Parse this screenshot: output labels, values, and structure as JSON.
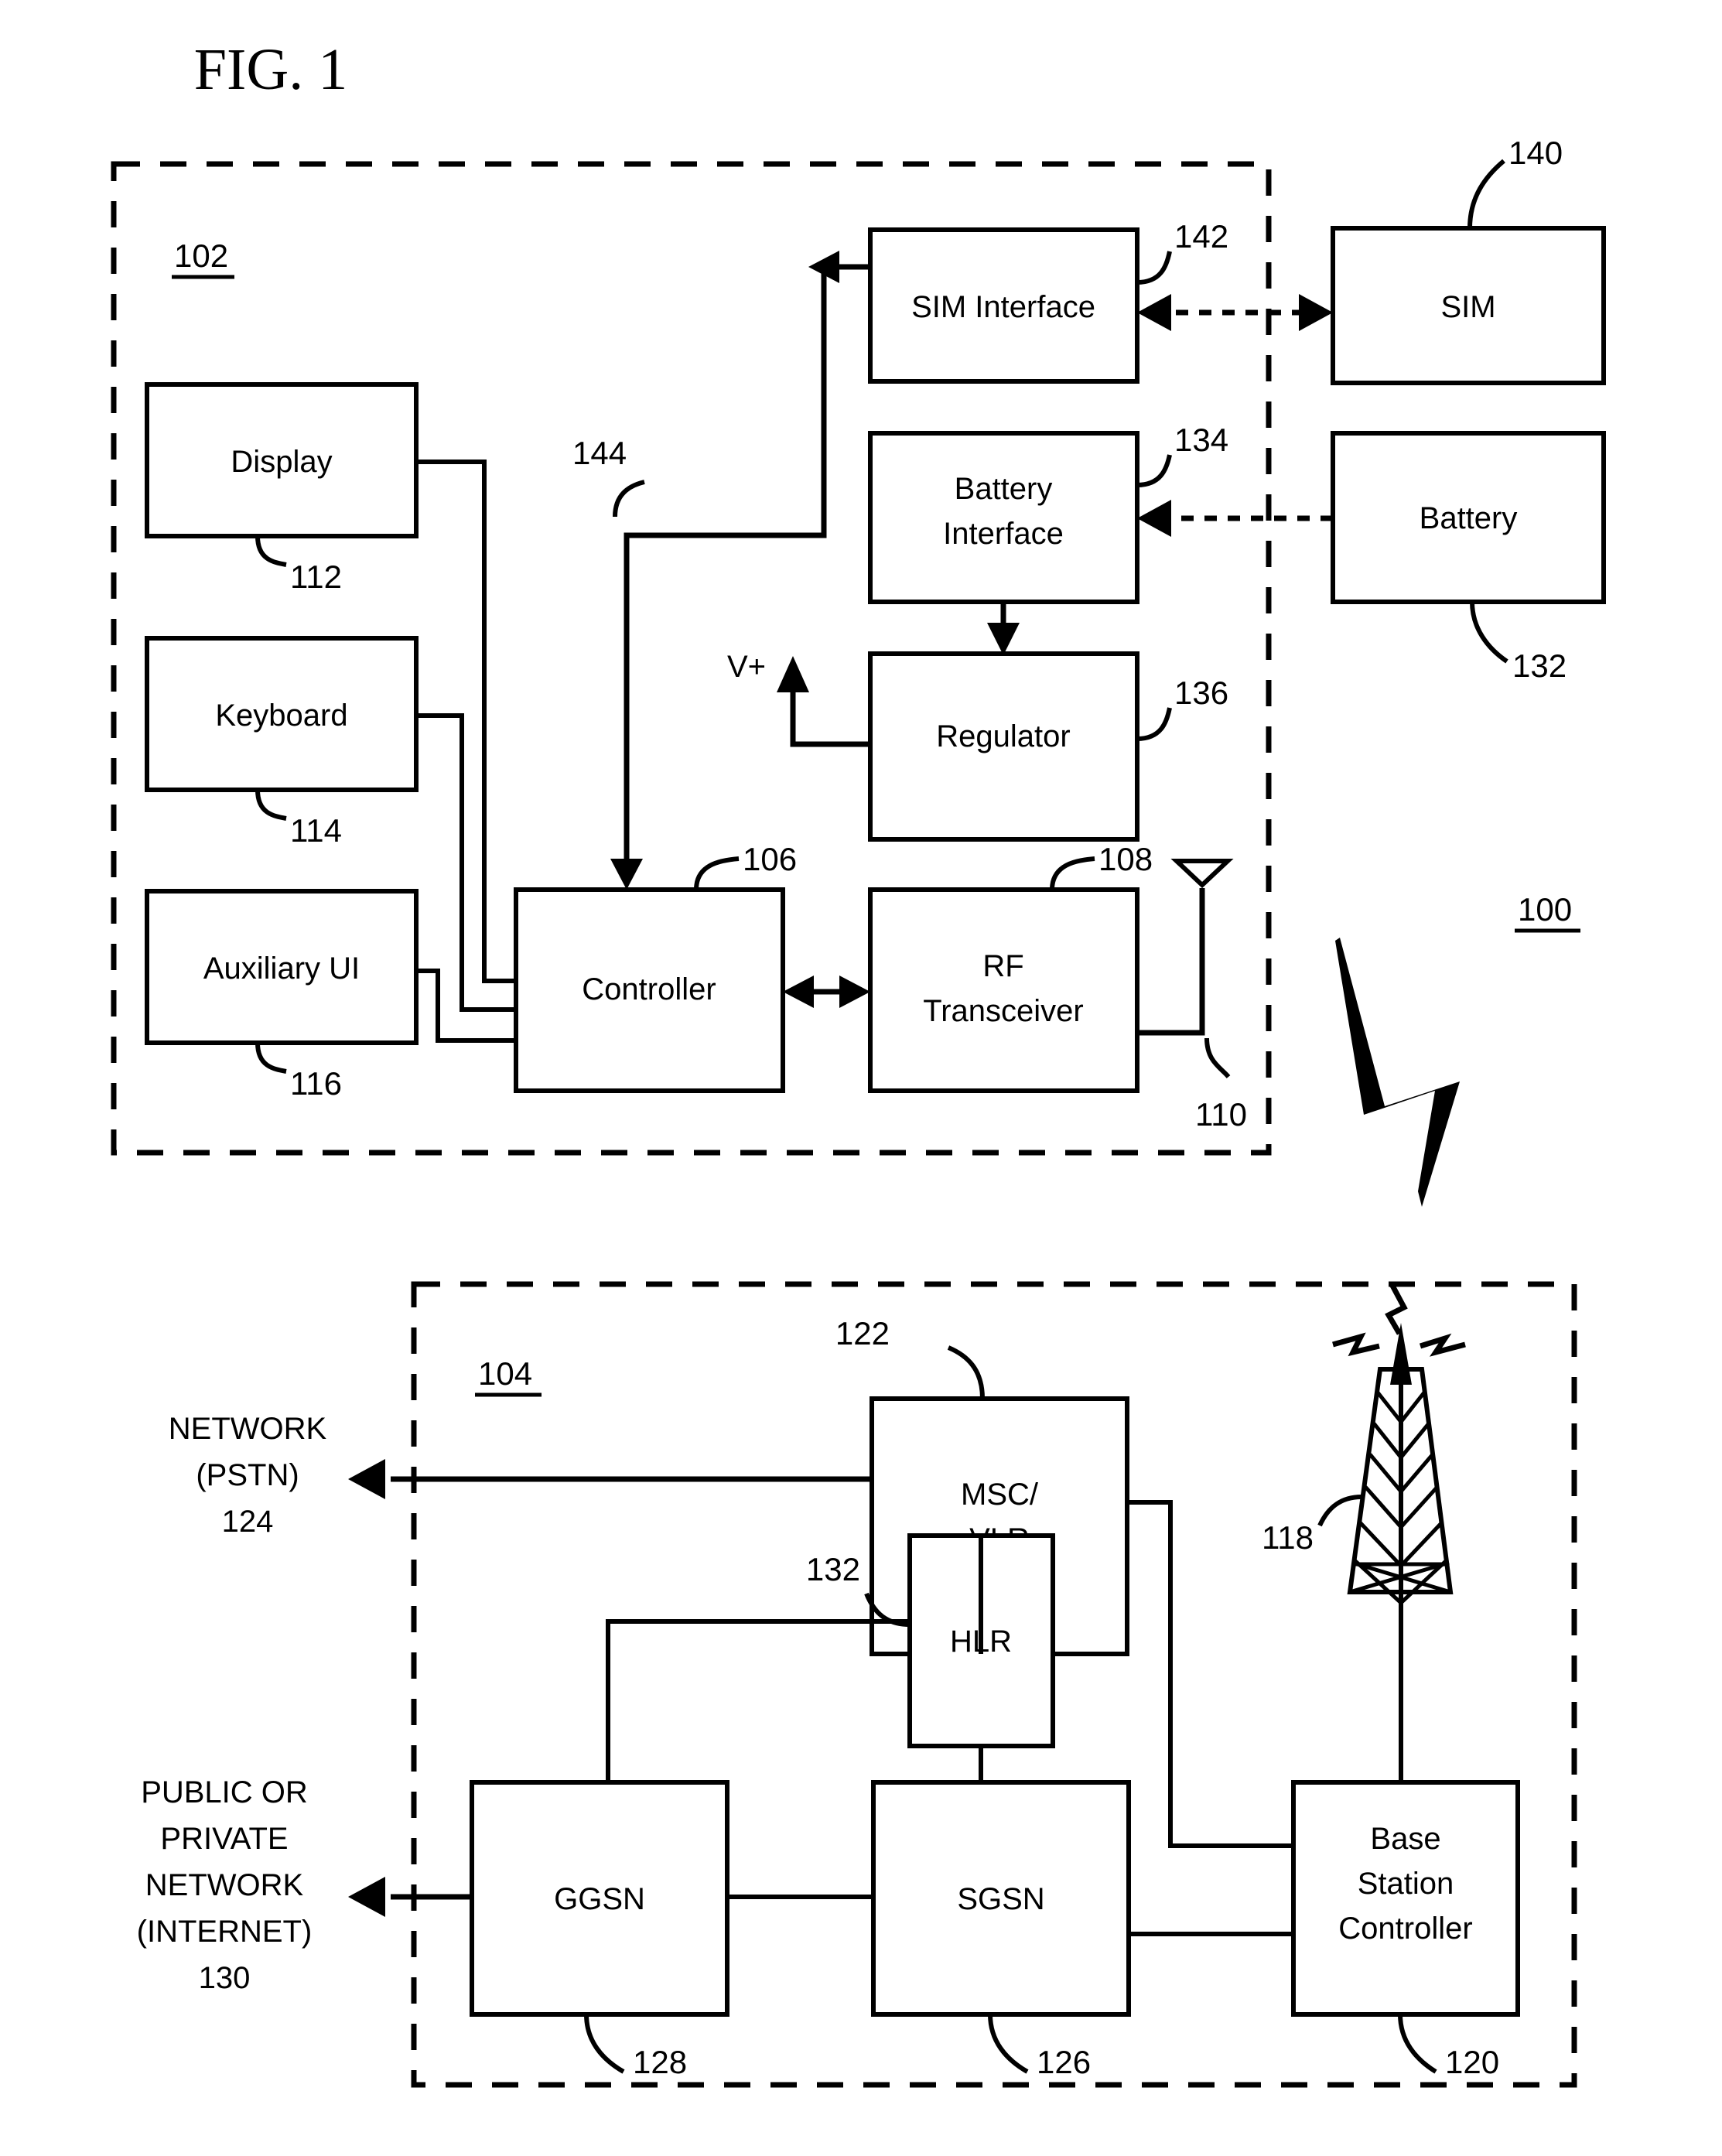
{
  "figure": {
    "title": "FIG. 1",
    "system_ref": "100"
  },
  "mobile_device": {
    "ref": "102",
    "blocks": [
      {
        "name": "display",
        "label": "Display",
        "ref": "112"
      },
      {
        "name": "keyboard",
        "label": "Keyboard",
        "ref": "114"
      },
      {
        "name": "auxiliary-ui",
        "label": "Auxiliary UI",
        "ref": "116"
      },
      {
        "name": "controller",
        "label": "Controller",
        "ref": "106"
      },
      {
        "name": "rf-transceiver",
        "label_line1": "RF",
        "label_line2": "Transceiver",
        "ref": "108"
      },
      {
        "name": "sim-interface",
        "label": "SIM Interface",
        "ref": "142"
      },
      {
        "name": "battery-interface",
        "label_line1": "Battery",
        "label_line2": "Interface",
        "ref": "134"
      },
      {
        "name": "regulator",
        "label": "Regulator",
        "ref": "136"
      }
    ],
    "antenna_ref": "110",
    "power_rail_label": "V+",
    "sim_bus_ref": "144"
  },
  "external": [
    {
      "name": "sim",
      "label": "SIM",
      "ref": "140"
    },
    {
      "name": "battery",
      "label": "Battery",
      "ref": "132"
    }
  ],
  "network": {
    "ref": "104",
    "blocks": [
      {
        "name": "msc-vlr",
        "label_line1": "MSC/",
        "label_line2": "VLR",
        "ref": "122"
      },
      {
        "name": "hlr",
        "label": "HLR",
        "ref": "132"
      },
      {
        "name": "ggsn",
        "label": "GGSN",
        "ref": "128"
      },
      {
        "name": "sgsn",
        "label": "SGSN",
        "ref": "126"
      },
      {
        "name": "base-station-controller",
        "label_line1": "Base",
        "label_line2": "Station",
        "label_line3": "Controller",
        "ref": "120"
      }
    ],
    "tower_ref": "118",
    "pstn": {
      "line1": "NETWORK",
      "line2": "(PSTN)",
      "line3": "124"
    },
    "internet": {
      "line1": "PUBLIC OR",
      "line2": "PRIVATE",
      "line3": "NETWORK",
      "line4": "(INTERNET)",
      "line5": "130"
    }
  }
}
